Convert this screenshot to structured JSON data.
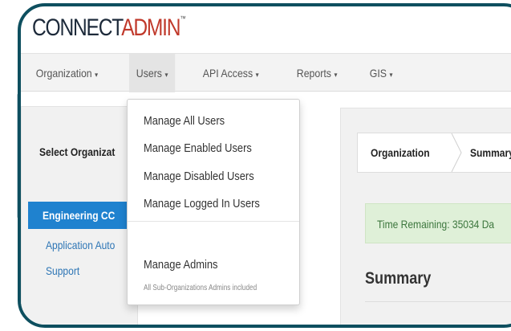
{
  "logo": {
    "part1": "CONNECT",
    "part2": "ADMIN",
    "mark": "™"
  },
  "nav": {
    "items": [
      {
        "label": "Organization",
        "caret": "▾"
      },
      {
        "label": "Users",
        "caret": "▾"
      },
      {
        "label": "API Access",
        "caret": "▾"
      },
      {
        "label": "Reports",
        "caret": "▾"
      },
      {
        "label": "GIS",
        "caret": "▾"
      }
    ]
  },
  "left_panel": {
    "title": "Select Organizat",
    "orgs": [
      "Engineering CC",
      "Application Auto",
      "Support"
    ]
  },
  "breadcrumb": [
    "Organization",
    "Summary"
  ],
  "alert": {
    "text": "Time Remaining: 35034 Da"
  },
  "summary": {
    "heading": "Summary"
  },
  "dropdown": {
    "items": [
      "Manage All Users",
      "Manage Enabled Users",
      "Manage Disabled Users",
      "Manage Logged In Users"
    ],
    "admins": "Manage Admins",
    "admins_note": "All Sub-Organizations Admins included"
  },
  "colors": {
    "frame": "#0e4f5f",
    "active_org": "#1f82cf",
    "alert_bg": "#dff0d8",
    "logo_accent": "#c0392b"
  }
}
